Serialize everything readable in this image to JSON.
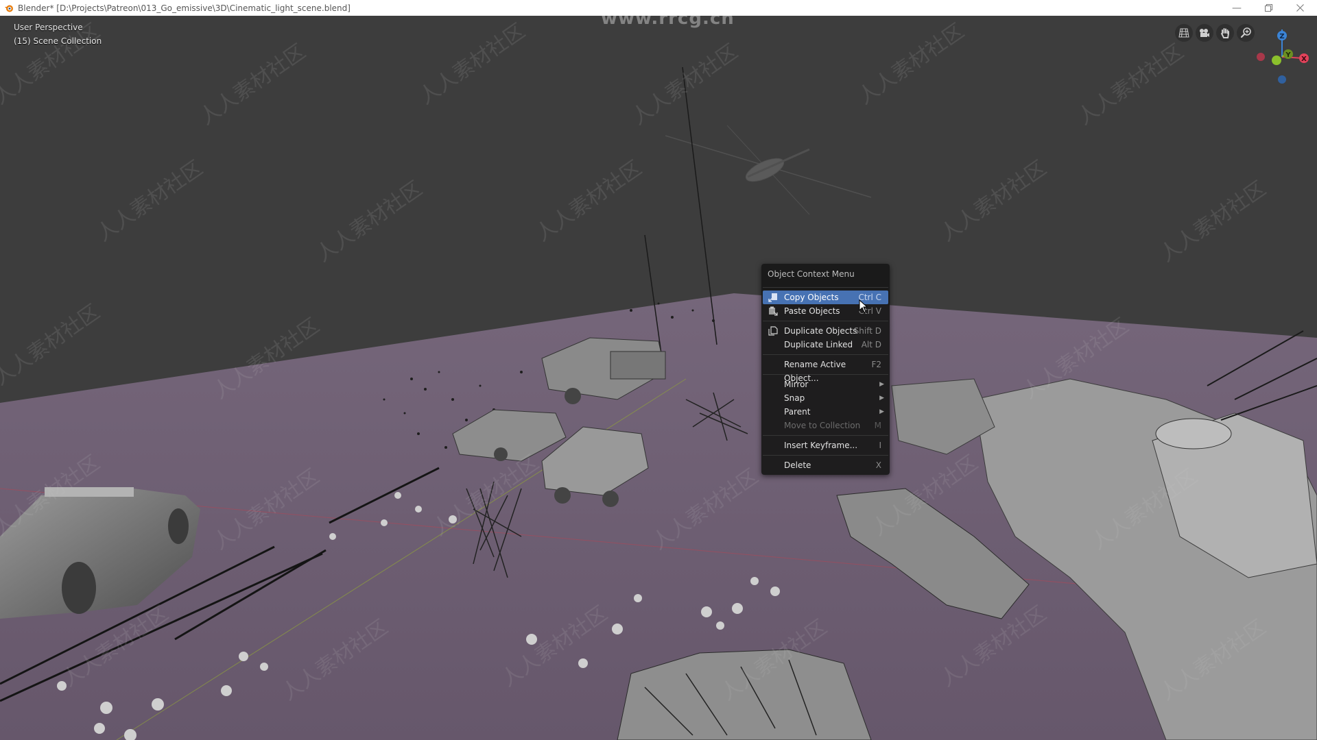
{
  "window": {
    "title": "Blender* [D:\\Projects\\Patreon\\013_Go_emissive\\3D\\Cinematic_light_scene.blend]",
    "app_icon": "blender-logo-icon",
    "controls": [
      "minimize-icon",
      "restore-icon",
      "close-icon"
    ]
  },
  "viewport": {
    "view_name": "User Perspective",
    "collection": "(15) Scene Collection",
    "nav_buttons": [
      "toggle-camera-grid-icon",
      "camera-view-icon",
      "pan-hand-icon",
      "zoom-icon"
    ],
    "gizmo_axes": {
      "x": "X",
      "y": "Y",
      "z": "Z"
    },
    "colors": {
      "background": "#3d3d3d",
      "floor": "#6e5f70",
      "x_axis": "#e2425a",
      "y_axis": "#8bc02c",
      "z_axis": "#3b84d6"
    },
    "watermark_top": "www.rrcg.cn",
    "watermark_repeat": "人人素材社区"
  },
  "context_menu": {
    "title": "Object Context Menu",
    "accent": "#4772b3",
    "groups": [
      [
        {
          "label": "Copy Objects",
          "shortcut": "Ctrl C",
          "icon": "copy-icon",
          "active": true
        },
        {
          "label": "Paste Objects",
          "shortcut": "Ctrl V",
          "icon": "paste-icon"
        }
      ],
      [
        {
          "label": "Duplicate Objects",
          "shortcut": "Shift D",
          "icon": "duplicate-icon"
        },
        {
          "label": "Duplicate Linked",
          "shortcut": "Alt D"
        }
      ],
      [
        {
          "label": "Rename Active Object...",
          "shortcut": "F2"
        }
      ],
      [
        {
          "label": "Mirror",
          "submenu": true
        },
        {
          "label": "Snap",
          "submenu": true
        },
        {
          "label": "Parent",
          "submenu": true
        },
        {
          "label": "Move to Collection",
          "shortcut": "M",
          "disabled": true
        }
      ],
      [
        {
          "label": "Insert Keyframe...",
          "shortcut": "I"
        }
      ],
      [
        {
          "label": "Delete",
          "shortcut": "X"
        }
      ]
    ]
  }
}
